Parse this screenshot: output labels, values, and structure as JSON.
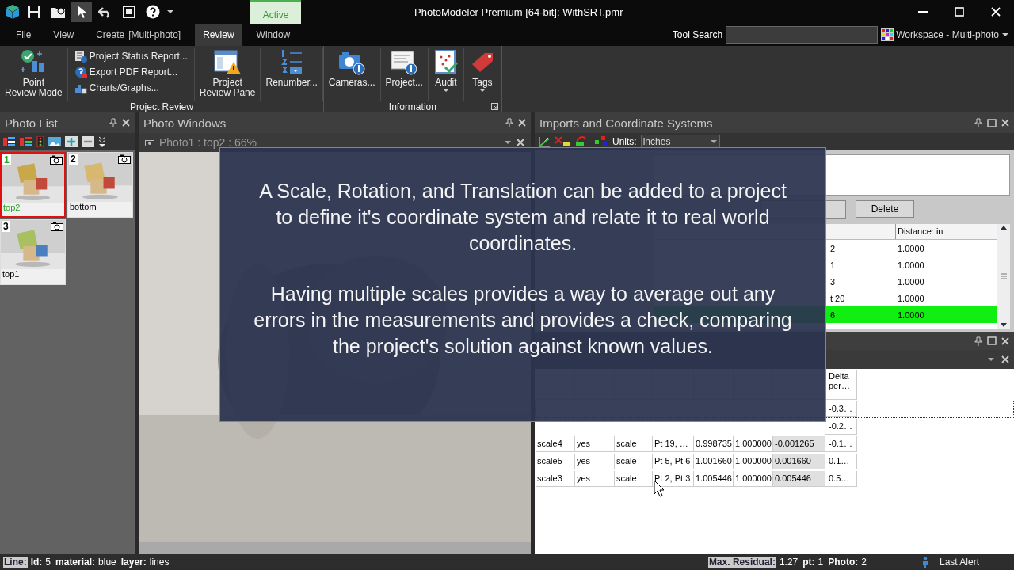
{
  "title_bar": {
    "context_tab": "Active",
    "title": "PhotoModeler Premium [64-bit]: WithSRT.pmr"
  },
  "menu_tabs": [
    {
      "label": "File",
      "selected": false
    },
    {
      "label": "View",
      "selected": false
    },
    {
      "label": "Create",
      "mode": "[Multi-photo]",
      "selected": false
    },
    {
      "label": "Review",
      "selected": true
    },
    {
      "label": "Window",
      "selected": false
    }
  ],
  "tool_search": {
    "label": "Tool Search"
  },
  "workspace": {
    "label": "Workspace - Multi-photo"
  },
  "ribbon": {
    "groups": [
      {
        "label": "Project Review",
        "items": [
          {
            "kind": "large",
            "label": "Point\nReview Mode"
          },
          {
            "kind": "stack",
            "entries": [
              "Project Status Report...",
              "Export PDF Report...",
              "Charts/Graphs..."
            ]
          },
          {
            "kind": "large",
            "label": "Project\nReview Pane"
          },
          {
            "kind": "large",
            "label": "Renumber..."
          }
        ]
      },
      {
        "label": "Information",
        "launcher": true,
        "items": [
          {
            "kind": "large",
            "label": "Cameras..."
          },
          {
            "kind": "large",
            "label": "Project..."
          },
          {
            "kind": "dropdown",
            "label": "Audit"
          },
          {
            "kind": "dropdown",
            "label": "Tags"
          }
        ]
      }
    ]
  },
  "photo_list": {
    "title": "Photo List",
    "photos": [
      {
        "number": "1",
        "name": "top2",
        "selected": true
      },
      {
        "number": "2",
        "name": "bottom",
        "selected": false
      },
      {
        "number": "3",
        "name": "top1",
        "selected": false
      }
    ]
  },
  "photo_windows": {
    "title": "Photo Windows",
    "tab": "Photo1 : top2 : 66%"
  },
  "imports": {
    "title": "Imports and Coordinate Systems",
    "units_label": "Units:",
    "units": "inches",
    "delete_button": "Delete",
    "table": {
      "columns": [
        "Distance: in"
      ],
      "rows": [
        {
          "column_1": "2",
          "distance": "1.0000",
          "selected": false
        },
        {
          "column_1": "1",
          "distance": "1.0000",
          "selected": false
        },
        {
          "column_1": "3",
          "distance": "1.0000",
          "selected": false
        },
        {
          "column_1": "t 20",
          "distance": "1.0000",
          "selected": false
        },
        {
          "column_1": "6",
          "distance": "1.0000",
          "selected": true
        }
      ]
    }
  },
  "measurements": {
    "columns": [
      "Delta\nper…"
    ],
    "rows": [
      {
        "cells": [
          "-0.3…"
        ],
        "focused": true
      },
      {
        "cells": [
          "-0.2…"
        ],
        "focused": false
      },
      {
        "cells": [
          "scale4",
          "yes",
          "scale",
          "Pt 19, …",
          "0.998735",
          "1.000000",
          "-0.001265",
          "-0.1…"
        ],
        "focused": false
      },
      {
        "cells": [
          "scale5",
          "yes",
          "scale",
          "Pt 5, Pt 6",
          "1.001660",
          "1.000000",
          "0.001660",
          "0.1…"
        ],
        "focused": false
      },
      {
        "cells": [
          "scale3",
          "yes",
          "scale",
          "Pt 2, Pt 3",
          "1.005446",
          "1.000000",
          "0.005446",
          "0.5…"
        ],
        "focused": false
      }
    ]
  },
  "overlay": {
    "paragraphs": [
      "A Scale, Rotation, and Translation can be added to a project to define it's coordinate system and relate it to real world coordinates.",
      "Having multiple scales provides a way to average out any errors in the measurements and provides a check, comparing the project's solution against known values."
    ]
  },
  "status_bar": {
    "left": [
      {
        "text": "Line:",
        "kind": "heading"
      },
      {
        "text": "Id:",
        "kind": "key"
      },
      {
        "text": "5",
        "kind": "value"
      },
      {
        "text": "material:",
        "kind": "key"
      },
      {
        "text": "blue",
        "kind": "value"
      },
      {
        "text": "layer:",
        "kind": "key"
      },
      {
        "text": "lines",
        "kind": "value"
      }
    ],
    "right": [
      {
        "text": "Max. Residual:",
        "kind": "heading"
      },
      {
        "text": "1.27",
        "kind": "value"
      },
      {
        "text": "pt:",
        "kind": "key"
      },
      {
        "text": "1",
        "kind": "value"
      },
      {
        "text": "Photo:",
        "kind": "key"
      },
      {
        "text": "2",
        "kind": "value"
      }
    ],
    "alert": "Last Alert"
  }
}
